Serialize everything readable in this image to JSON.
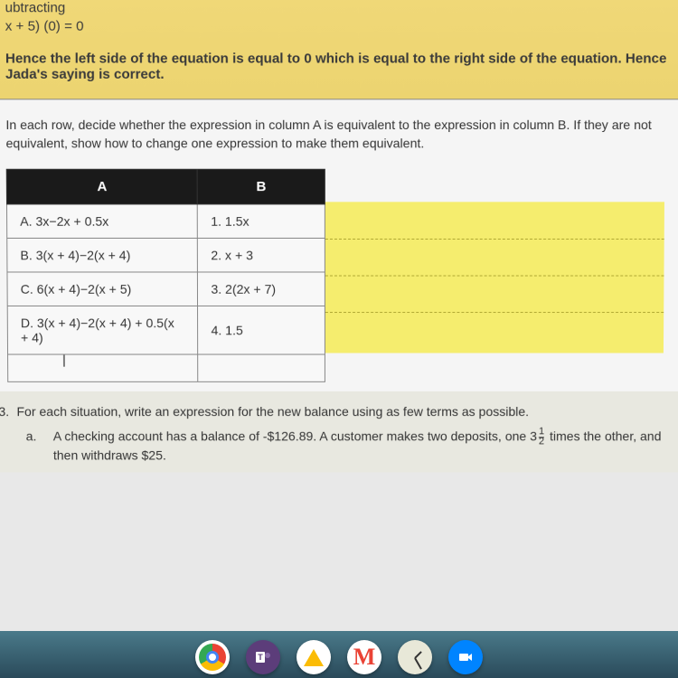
{
  "top": {
    "line1": "ubtracting",
    "line2": "x + 5) (0) = 0",
    "conclusion": "Hence the left side of the equation is equal to 0 which is equal to the right side of the equation. Hence Jada's saying is correct."
  },
  "instruction": "In each row, decide whether the expression in column A is equivalent to the expression in column B. If they are not equivalent, show how to change one expression to make them equivalent.",
  "table": {
    "headers": {
      "a": "A",
      "b": "B"
    },
    "rows": [
      {
        "a": "A.    3x−2x + 0.5x",
        "b": "1.    1.5x"
      },
      {
        "a": "B.    3(x + 4)−2(x + 4)",
        "b": "2.  x + 3"
      },
      {
        "a": "C.     6(x + 4)−2(x + 5)",
        "b": "3.  2(2x + 7)"
      },
      {
        "a": "D.     3(x + 4)−2(x + 4) + 0.5(x + 4)",
        "b": "4. 1.5"
      }
    ]
  },
  "question": {
    "number": "3.",
    "text": "For each situation, write an expression for the new balance using as few terms as possible.",
    "sub_letter": "a.",
    "sub_text_1": "A checking account has a balance of -$126.89. A customer makes two deposits, one ",
    "frac_whole": "3",
    "frac_top": "1",
    "frac_bot": "2",
    "sub_text_2": " times the other, and then withdraws $25."
  },
  "dock": {
    "chrome": "chrome",
    "teams": "teams",
    "drive": "drive",
    "gmail": "gmail",
    "clock": "clock",
    "camera": "camera"
  }
}
